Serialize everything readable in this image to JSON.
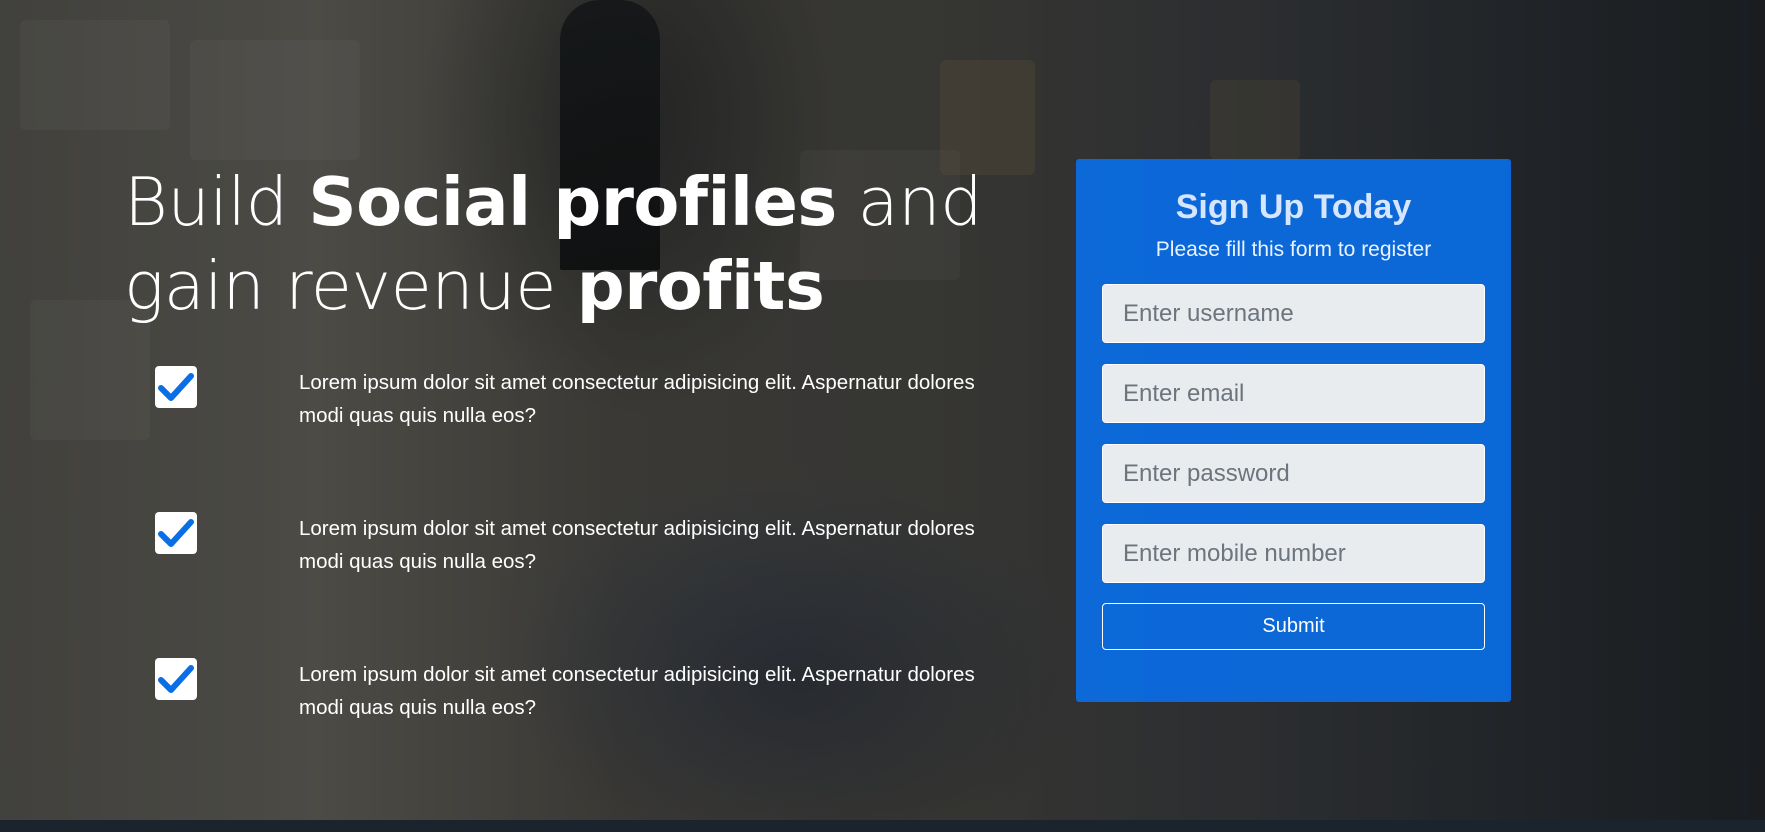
{
  "hero": {
    "headline": {
      "part1": "Build ",
      "part2": "Social profiles",
      "part3": " and gain revenue ",
      "part4": "profits"
    },
    "features": [
      {
        "icon": "check-icon",
        "text": "Lorem ipsum dolor sit amet consectetur adipisicing elit. Aspernatur dolores modi quas quis nulla eos?"
      },
      {
        "icon": "check-icon",
        "text": "Lorem ipsum dolor sit amet consectetur adipisicing elit. Aspernatur dolores modi quas quis nulla eos?"
      },
      {
        "icon": "check-icon",
        "text": "Lorem ipsum dolor sit amet consectetur adipisicing elit. Aspernatur dolores modi quas quis nulla eos?"
      }
    ]
  },
  "signup": {
    "title": "Sign Up Today",
    "subtitle": "Please fill this form to register",
    "username_placeholder": "Enter username",
    "email_placeholder": "Enter email",
    "password_placeholder": "Enter password",
    "mobile_placeholder": "Enter mobile number",
    "submit_label": "Submit"
  },
  "colors": {
    "form_background": "#0a6ee6",
    "check_color": "#0a6ee6",
    "text": "#ffffff"
  }
}
